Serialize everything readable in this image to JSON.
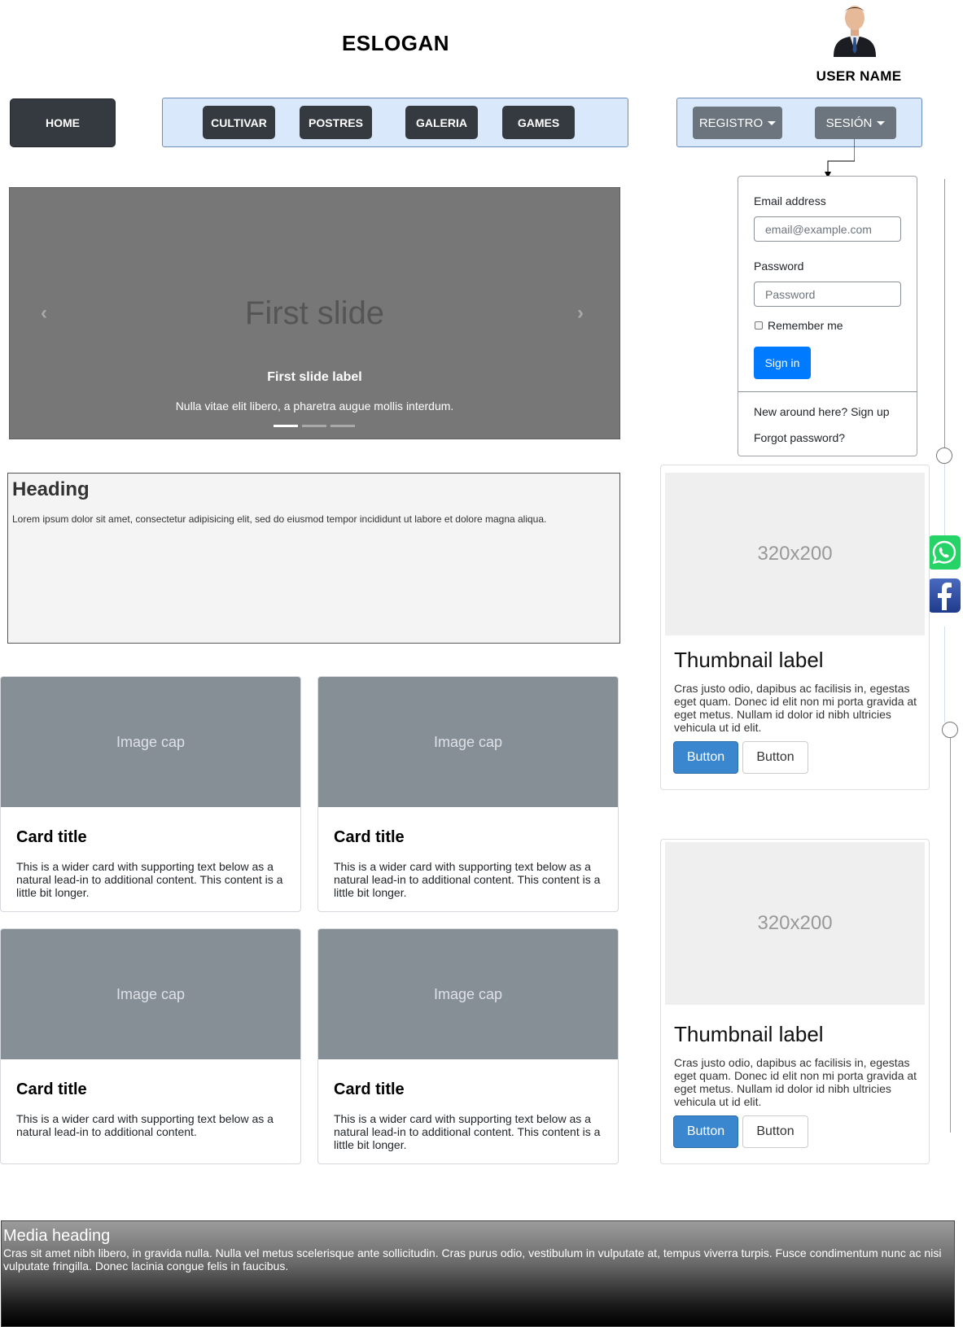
{
  "header": {
    "slogan": "ESLOGAN",
    "username": "USER NAME",
    "avatar_icon": "user-avatar-icon"
  },
  "nav": {
    "home": "HOME",
    "items": [
      "CULTIVAR",
      "POSTRES",
      "GALERIA",
      "GAMES"
    ],
    "registro": "REGISTRO",
    "sesion": "SESIÓN"
  },
  "login": {
    "email_label": "Email address",
    "email_placeholder": "email@example.com",
    "password_label": "Password",
    "password_placeholder": "Password",
    "remember": "Remember me",
    "signin": "Sign in",
    "signup": "New around here? Sign up",
    "forgot": "Forgot password?"
  },
  "carousel": {
    "slide_text": "First slide",
    "label": "First slide label",
    "caption": "Nulla vitae elit libero, a pharetra augue mollis interdum.",
    "prev_icon": "chevron-left-icon",
    "next_icon": "chevron-right-icon",
    "indicator_count": 3,
    "active_index": 0
  },
  "heading_box": {
    "title": "Heading",
    "text": "Lorem ipsum dolor sit amet, consectetur adipisicing elit, sed do eiusmod tempor incididunt ut labore et dolore magna aliqua."
  },
  "cards": [
    {
      "cap": "Image cap",
      "title": "Card title",
      "text": "This is a wider card with supporting text below as a natural lead-in to additional content. This content is a little bit longer."
    },
    {
      "cap": "Image cap",
      "title": "Card title",
      "text": "This is a wider card with supporting text below as a natural lead-in to additional content. This content is a little bit longer."
    },
    {
      "cap": "Image cap",
      "title": "Card title",
      "text": "This is a wider card with supporting text below as a natural lead-in to additional content."
    },
    {
      "cap": "Image cap",
      "title": "Card title",
      "text": "This is a wider card with supporting text below as a natural lead-in to additional content. This content is a little bit longer."
    }
  ],
  "thumbnails": [
    {
      "image": "320x200",
      "label": "Thumbnail label",
      "text": "Cras justo odio, dapibus ac facilisis in, egestas eget quam. Donec id elit non mi porta gravida at eget metus. Nullam id dolor id nibh ultricies vehicula ut id elit.",
      "primary": "Button",
      "secondary": "Button"
    },
    {
      "image": "320x200",
      "label": "Thumbnail label",
      "text": "Cras justo odio, dapibus ac facilisis in, egestas eget quam. Donec id elit non mi porta gravida at eget metus. Nullam id dolor id nibh ultricies vehicula ut id elit.",
      "primary": "Button",
      "secondary": "Button"
    }
  ],
  "social": {
    "whatsapp_icon": "whatsapp-icon",
    "facebook_icon": "facebook-icon",
    "colors": {
      "whatsapp": "#25d366",
      "facebook": "#3b5998"
    }
  },
  "media": {
    "heading": "Media heading",
    "text": "Cras sit amet nibh libero, in gravida nulla. Nulla vel metus scelerisque ante sollicitudin. Cras purus odio, vestibulum in vulputate at, tempus viverra turpis. Fusce condimentum nunc ac nisi vulputate fringilla. Donec lacinia congue felis in faucibus."
  },
  "colors": {
    "dark_button": "#343a40",
    "secondary_button": "#6c757d",
    "nav_background": "#dae8fc",
    "nav_border": "#6c8ebf",
    "primary": "#007bff",
    "carousel": "#777777",
    "image_cap": "#868e96"
  }
}
